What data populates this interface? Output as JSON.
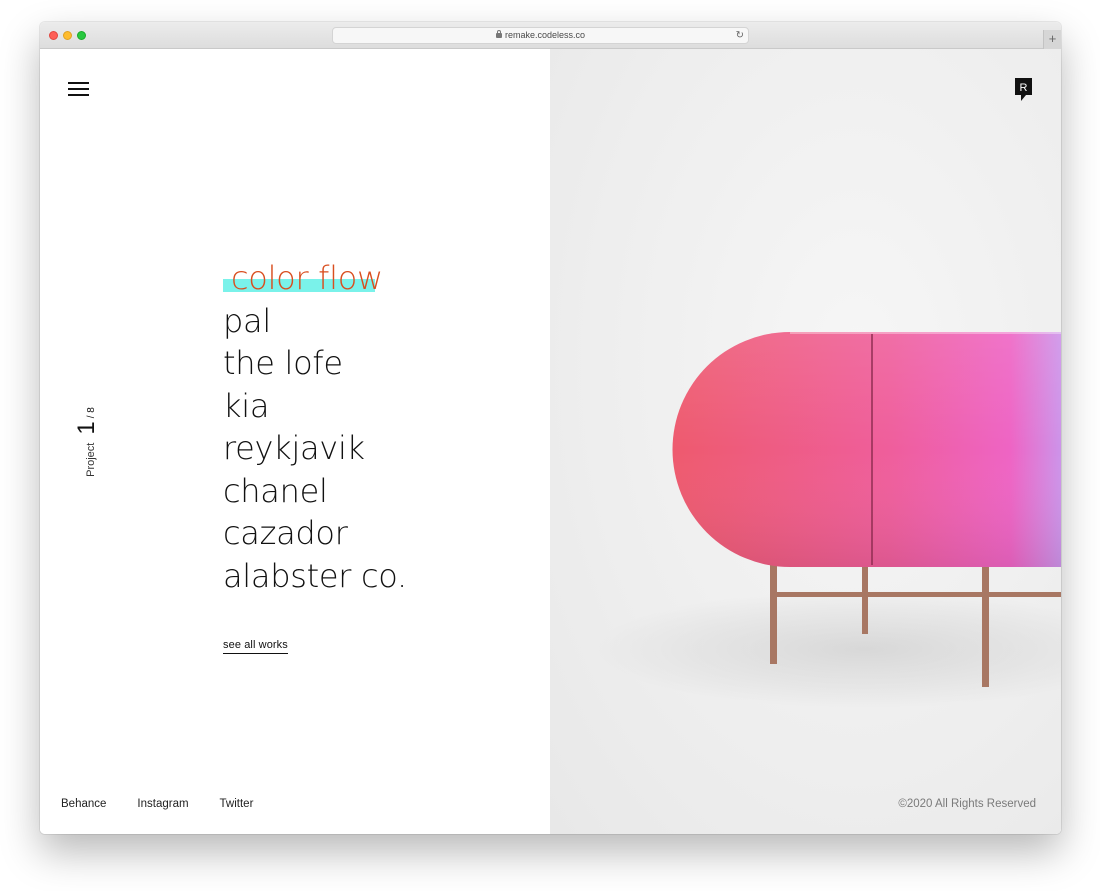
{
  "browser": {
    "url": "remake.codeless.co",
    "new_tab_symbol": "+",
    "reload_symbol": "↻"
  },
  "header": {
    "menu_icon": "hamburger-icon",
    "logo_letter": "R"
  },
  "counter": {
    "label": "Project",
    "current": "1",
    "total": "/ 8"
  },
  "projects": [
    {
      "label": "color flow",
      "active": true
    },
    {
      "label": "pal",
      "active": false
    },
    {
      "label": "the lofe",
      "active": false
    },
    {
      "label": "kia",
      "active": false
    },
    {
      "label": "reykjavik",
      "active": false
    },
    {
      "label": "chanel",
      "active": false
    },
    {
      "label": "cazador",
      "active": false
    },
    {
      "label": "alabster co.",
      "active": false
    }
  ],
  "see_all_label": "see all works",
  "social": [
    "Behance",
    "Instagram",
    "Twitter"
  ],
  "copyright": "©2020 All Rights Reserved",
  "colors": {
    "active_text": "#d94e1f",
    "highlight": "#7af2ea",
    "cabinet_start": "#ee5a6e",
    "cabinet_mid": "#f05fb0",
    "cabinet_end": "#c79cf0",
    "legs": "#a87763"
  }
}
